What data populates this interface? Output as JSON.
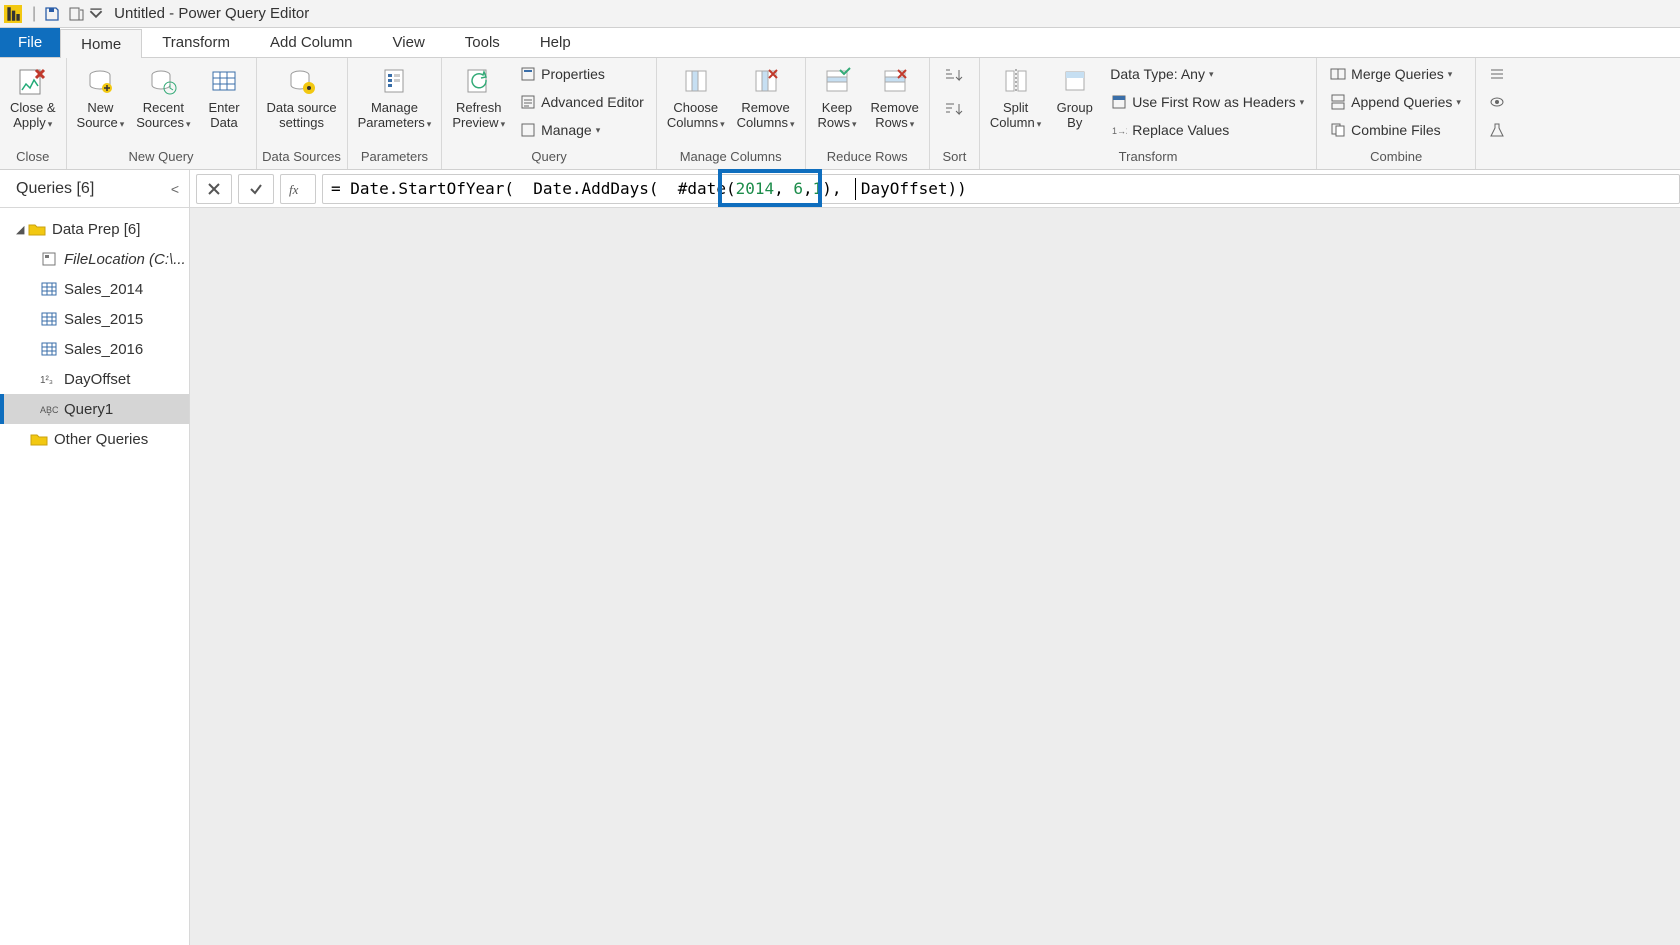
{
  "title": "Untitled - Power Query Editor",
  "tabs": {
    "file": "File",
    "home": "Home",
    "transform": "Transform",
    "addcolumn": "Add Column",
    "view": "View",
    "tools": "Tools",
    "help": "Help"
  },
  "ribbon": {
    "close": {
      "closeapply": "Close &\nApply",
      "group": "Close"
    },
    "newquery": {
      "newsource": "New\nSource",
      "recentsources": "Recent\nSources",
      "enterdata": "Enter\nData",
      "group": "New Query"
    },
    "datasources": {
      "settings": "Data source\nsettings",
      "group": "Data Sources"
    },
    "parameters": {
      "manage": "Manage\nParameters",
      "group": "Parameters"
    },
    "query": {
      "refresh": "Refresh\nPreview",
      "properties": "Properties",
      "advanced": "Advanced Editor",
      "manage": "Manage",
      "group": "Query"
    },
    "managecols": {
      "choose": "Choose\nColumns",
      "remove": "Remove\nColumns",
      "group": "Manage Columns"
    },
    "reducerows": {
      "keep": "Keep\nRows",
      "remove": "Remove\nRows",
      "group": "Reduce Rows"
    },
    "sort": {
      "group": "Sort"
    },
    "transform": {
      "split": "Split\nColumn",
      "groupby": "Group\nBy",
      "datatype": "Data Type: Any",
      "firstrow": "Use First Row as Headers",
      "replace": "Replace Values",
      "group": "Transform"
    },
    "combine": {
      "merge": "Merge Queries",
      "append": "Append Queries",
      "combinefiles": "Combine Files",
      "group": "Combine"
    }
  },
  "queries_panel": {
    "title": "Queries [6]",
    "group": "Data Prep [6]",
    "items": [
      {
        "name": "FileLocation (C:\\...",
        "type": "param",
        "italic": true
      },
      {
        "name": "Sales_2014",
        "type": "table"
      },
      {
        "name": "Sales_2015",
        "type": "table"
      },
      {
        "name": "Sales_2016",
        "type": "table"
      },
      {
        "name": "DayOffset",
        "type": "num"
      },
      {
        "name": "Query1",
        "type": "text",
        "selected": true
      }
    ],
    "other": "Other Queries"
  },
  "formula": {
    "prefix": "= Date.StartOfYear(  Date.AddDays(  #date(",
    "num1": "2014",
    "sep1": ", ",
    "num2": "6",
    "sep2": ",",
    "num3": "1",
    "mid": "),  ",
    "highlighted": "DayOffset))",
    "raw": "= Date.StartOfYear(  Date.AddDays(  #date(2014, 6,1),  DayOffset))"
  }
}
